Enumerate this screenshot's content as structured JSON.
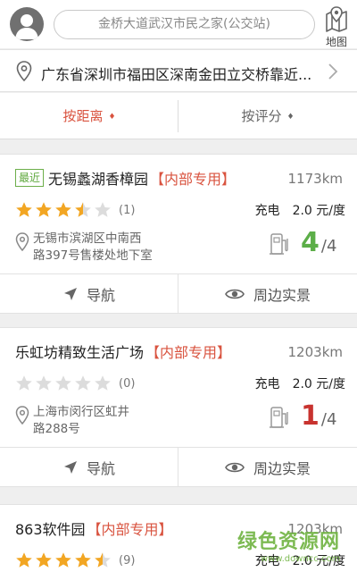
{
  "header": {
    "search_text": "金桥大道武汉市民之家(公交站)",
    "map_label": "地图"
  },
  "location": {
    "address": "广东省深圳市福田区深南金田立交桥靠近..."
  },
  "sort": {
    "distance": "按距离",
    "rating": "按评分",
    "arrow": "♦"
  },
  "stations": [
    {
      "badge": "最近",
      "name": "无锡蠡湖香樟园",
      "tag": "【内部专用】",
      "distance": "1173km",
      "rating": 3.5,
      "review_count": "(1)",
      "price_label": "充电",
      "price": "2.0 元/度",
      "address_line1": "无锡市滨湖区中南西",
      "address_line2": "路397号售楼处地下室",
      "available": "4",
      "total": "/4",
      "available_color": "#5cae48",
      "nav_label": "导航",
      "view_label": "周边实景"
    },
    {
      "badge": "",
      "name": "乐虹坊精致生活广场",
      "tag": "【内部专用】",
      "distance": "1203km",
      "rating": 0,
      "review_count": "(0)",
      "price_label": "充电",
      "price": "2.0 元/度",
      "address_line1": "上海市闵行区虹井",
      "address_line2": "路288号",
      "available": "1",
      "total": "/4",
      "available_color": "#c8332f",
      "nav_label": "导航",
      "view_label": "周边实景"
    },
    {
      "badge": "",
      "name": "863软件园",
      "tag": "【内部专用】",
      "distance": "1203km",
      "rating": 4.5,
      "review_count": "(9)",
      "price_label": "充电",
      "price": "2.0 元/度"
    }
  ],
  "watermark": {
    "text": "绿色资源网",
    "url": "www.downcc.com"
  },
  "colors": {
    "accent_red": "#d9533f",
    "green": "#5cae48",
    "star": "#f2a623",
    "star_empty": "#dcdcdc"
  }
}
